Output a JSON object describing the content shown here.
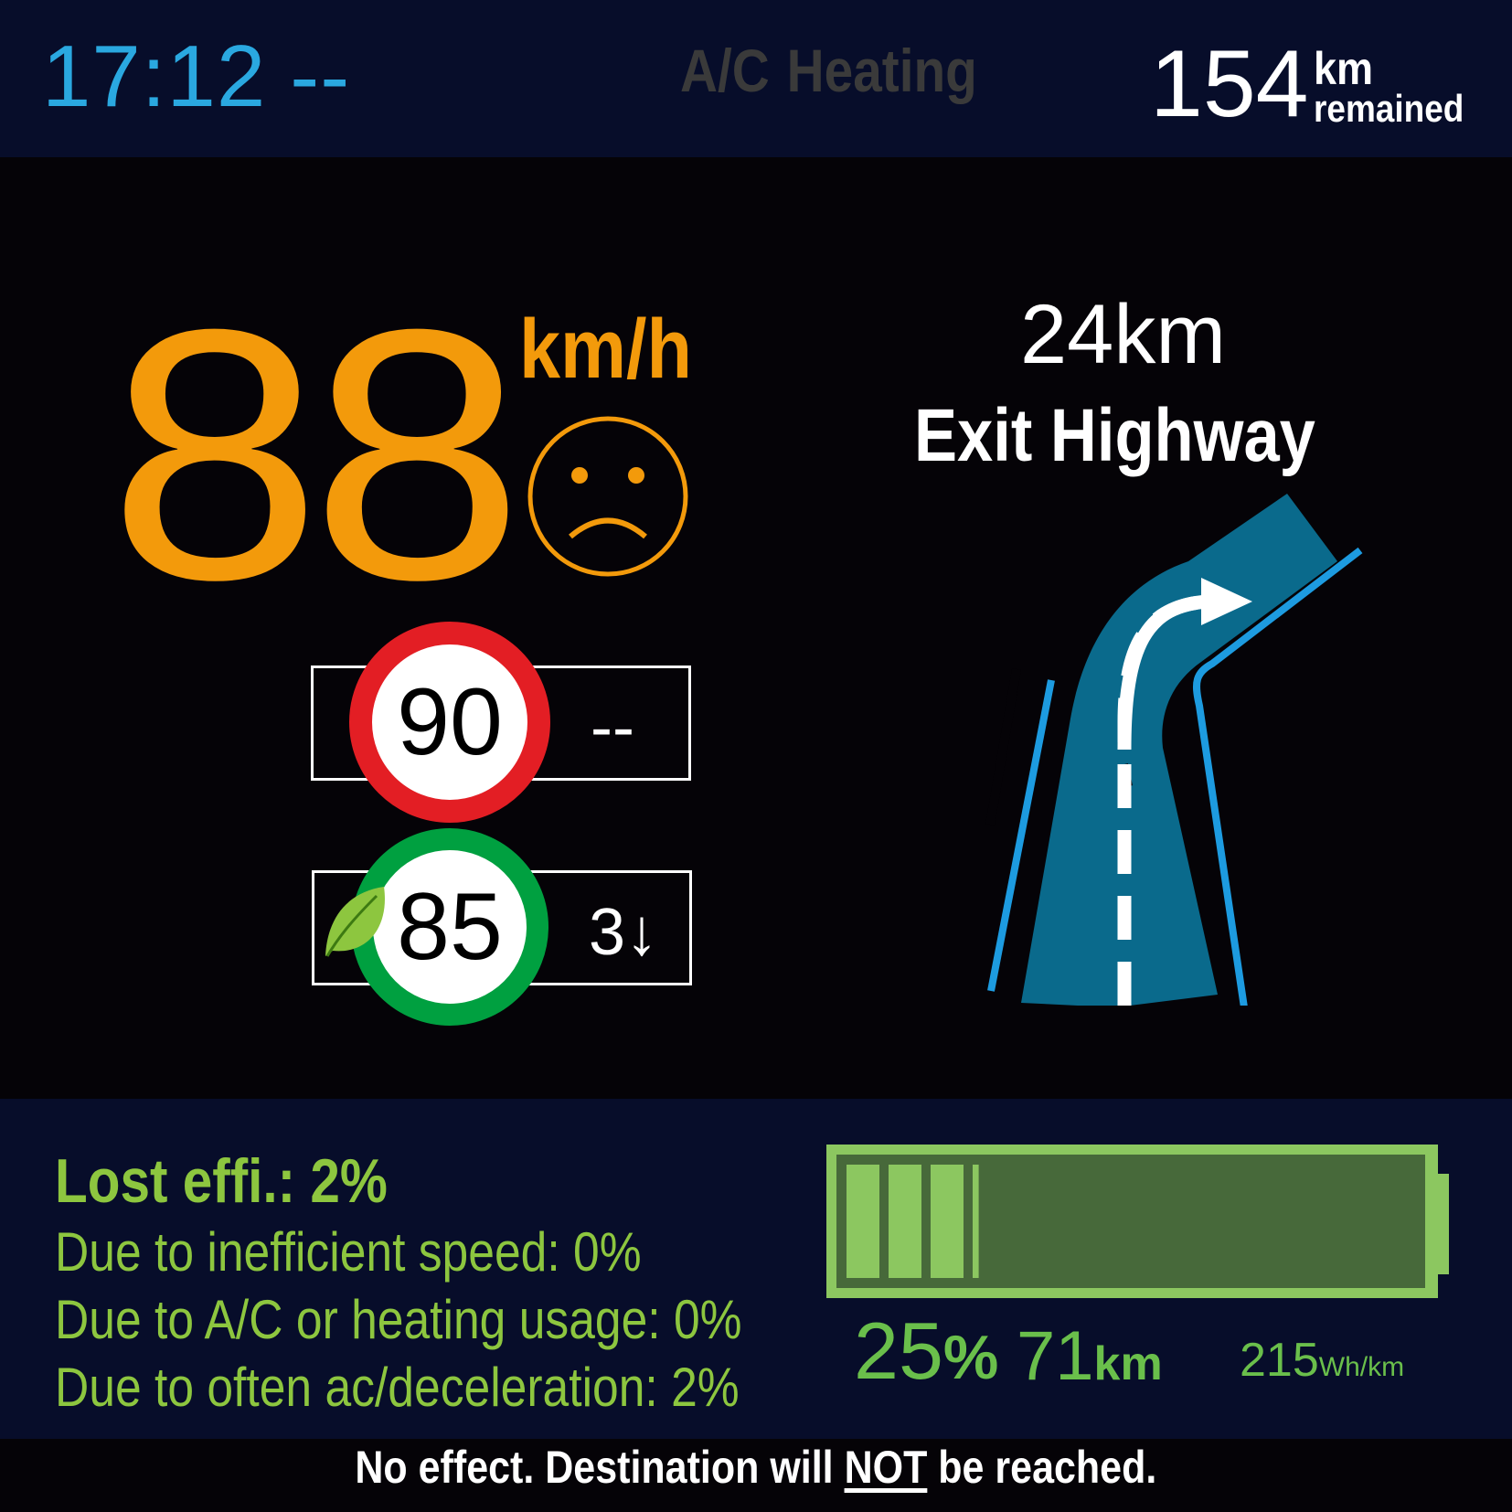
{
  "header": {
    "clock": "17:12",
    "clock_suffix": "--",
    "climate_ac": "A/C",
    "climate_heating": "Heating",
    "range_value": "154",
    "range_unit": "km",
    "range_label": "remained"
  },
  "speed": {
    "value": "88",
    "unit": "km/h",
    "mood_icon": "sad-face-icon"
  },
  "limits": {
    "legal": {
      "value": "90",
      "extra": "--"
    },
    "eco": {
      "value": "85",
      "extra": "3↓",
      "icon": "leaf-icon"
    }
  },
  "navigation": {
    "distance": "24km",
    "instruction": "Exit Highway",
    "icon": "highway-exit-right-icon"
  },
  "efficiency": {
    "lost": "Lost effi.: 2%",
    "due_speed": "Due to inefficient speed: 0%",
    "due_climate": "Due to A/C or heating usage: 0%",
    "due_accel": "Due to often ac/deceleration: 2%"
  },
  "battery": {
    "level_fraction": 0.25,
    "percent_value": "25",
    "percent_unit": "%",
    "range_value": "71",
    "range_unit": "km",
    "consumption_value": "215",
    "consumption_unit": "Wh/km"
  },
  "status": {
    "prefix": "No effect. Destination will",
    "emphasis": "NOT",
    "suffix": "be reached."
  },
  "colors": {
    "speed": "#f39a0b",
    "clock": "#2aa8e0",
    "efficiency": "#8dc63f",
    "battery": "#6abf4b",
    "road": "#0a6a8c",
    "lane_line": "#1d9be0",
    "legal_ring": "#e31e24",
    "eco_ring": "#00a040"
  }
}
